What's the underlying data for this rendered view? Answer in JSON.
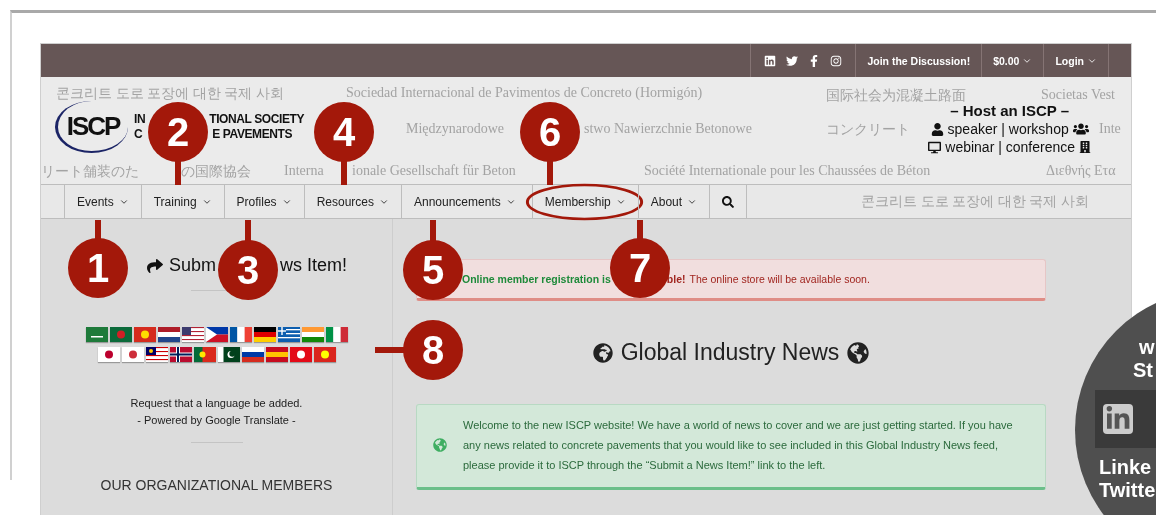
{
  "top_bar": {
    "social": [
      {
        "kind": "linkedin"
      },
      {
        "kind": "twitter"
      },
      {
        "kind": "facebook"
      },
      {
        "kind": "instagram"
      }
    ],
    "links": [
      {
        "label": "Join the Discussion!",
        "dropdown": false
      },
      {
        "label": "$0.00",
        "dropdown": true
      },
      {
        "label": "Login",
        "dropdown": true
      }
    ]
  },
  "header": {
    "background_phrases": [
      "콘크리트 도로 포장에 대한 국제 사회",
      "Sociedad Internacional de Pavimentos de Concreto (Hormigón)",
      "国际社会为混凝土路面",
      "Societas Vest",
      "Międzynarodowe",
      "stwo Nawierzchnie Betonowe",
      "コンクリート",
      "Inte",
      "リート舗装のた",
      "の国際協会",
      "Interna",
      "ionale Gesellschaft für Beton",
      "Société Internationale pour les Chaussées de Béton",
      "Διεθνής Ετα"
    ],
    "logo": {
      "mark": "ISCP",
      "line_1": [
        "IN",
        "TIONAL SOCIETY"
      ],
      "line_2": [
        "C",
        "E PAVEMENTS"
      ]
    },
    "host": {
      "title": "– Host an ISCP –",
      "line_1": "speaker | workshop",
      "line_2": "webinar | conference"
    }
  },
  "nav": {
    "items": [
      {
        "label": "Events",
        "dropdown": true,
        "circled": false
      },
      {
        "label": "Training",
        "dropdown": true,
        "circled": false
      },
      {
        "label": "Profiles",
        "dropdown": true,
        "circled": false
      },
      {
        "label": "Resources",
        "dropdown": true,
        "circled": false
      },
      {
        "label": "Announcements",
        "dropdown": true,
        "circled": false
      },
      {
        "label": "Membership",
        "dropdown": true,
        "circled": true
      },
      {
        "label": "About",
        "dropdown": true,
        "circled": false
      }
    ],
    "background_phrase": "콘크리트 도로 포장에 대한 국제 사회"
  },
  "sidebar": {
    "submit_link": [
      "Subm",
      "ws Item!"
    ],
    "request_text": "Request that a language be added.",
    "powered_text": "- Powered by Google Translate -",
    "members_heading": "OUR ORGANIZATIONAL MEMBERS"
  },
  "main": {
    "alert": {
      "parts": [
        {
          "kind": "success",
          "text": "Online member registration is"
        },
        {
          "kind": "strong",
          "text": "ble!"
        },
        {
          "kind": "plain",
          "text": "The online store will be available soon."
        }
      ]
    },
    "title": "Global Industry News",
    "welcome": "Welcome to the new ISCP website! We have a world of news to cover and we are just getting started.  If you have any news related to concrete pavements that you would like to see included in this Global Industry News feed, please provide it to ISCP through the “Submit a News Item!” link to the left."
  },
  "zoom_inset": {
    "lines_top": [
      "w",
      "St"
    ],
    "lines_bottom": [
      "Linke",
      "Twitte"
    ]
  },
  "annotations": [
    {
      "label": "1",
      "kind": "up"
    },
    {
      "label": "2",
      "kind": "down"
    },
    {
      "label": "3",
      "kind": "up"
    },
    {
      "label": "4",
      "kind": "down"
    },
    {
      "label": "5",
      "kind": "up"
    },
    {
      "label": "6",
      "kind": "down"
    },
    {
      "label": "7",
      "kind": "up"
    },
    {
      "label": "8",
      "kind": "left"
    }
  ]
}
